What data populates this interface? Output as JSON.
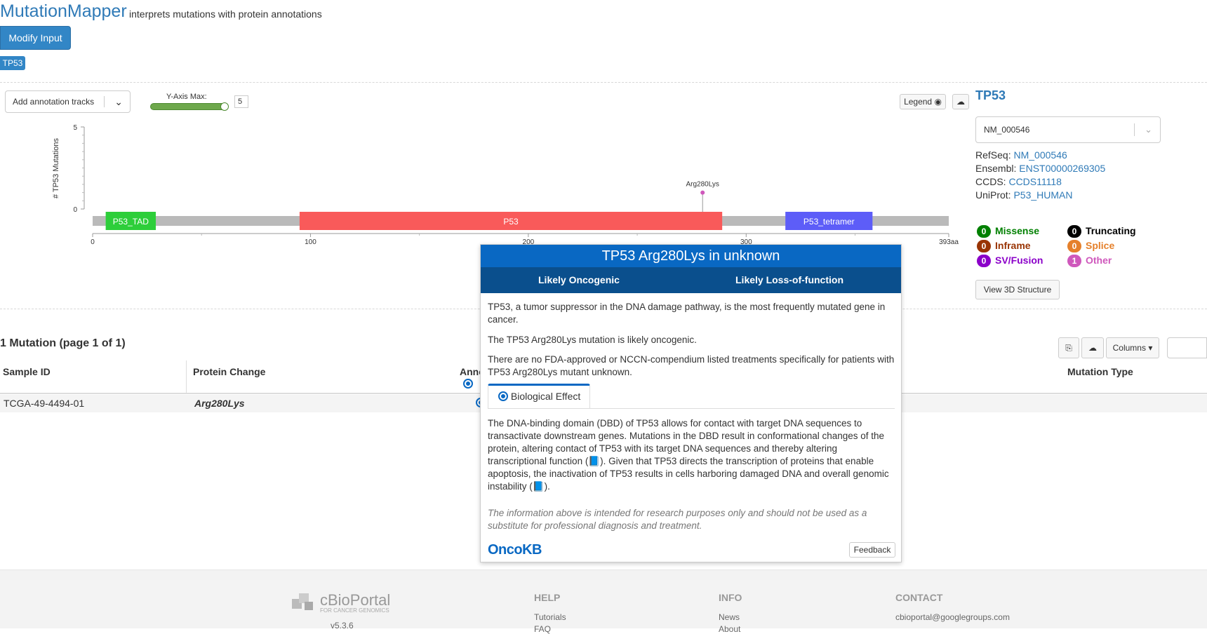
{
  "header": {
    "app_name": "MutationMapper",
    "subtitle": "interprets mutations with protein annotations",
    "modify_input_label": "Modify Input",
    "gene_tab": "TP53"
  },
  "controls": {
    "annotation_tracks_placeholder": "Add annotation tracks",
    "y_axis_label": "Y-Axis Max:",
    "y_axis_value": "5",
    "legend_button": "Legend"
  },
  "lollipop": {
    "y_label": "# TP53 Mutations",
    "y_ticks": [
      "5",
      "0"
    ],
    "x_ticks": [
      "0",
      "100",
      "200",
      "300",
      "393aa"
    ],
    "mutation_label": "Arg280Lys",
    "domains": [
      {
        "name": "P53_TAD",
        "color": "#2dce3a",
        "start": 6,
        "end": 29
      },
      {
        "name": "P53",
        "color": "#f95a5a",
        "start": 95,
        "end": 289
      },
      {
        "name": "P53_tetramer",
        "color": "#5d5df8",
        "start": 318,
        "end": 358
      }
    ],
    "protein_length": 393,
    "mutation_position": 280,
    "mutation_count": 1
  },
  "gene_panel": {
    "title": "TP53",
    "transcript": "NM_000546",
    "refseq_label": "RefSeq:",
    "refseq_value": "NM_000546",
    "ensembl_label": "Ensembl:",
    "ensembl_value": "ENST00000269305",
    "ccds_label": "CCDS:",
    "ccds_value": "CCDS11118",
    "uniprot_label": "UniProt:",
    "uniprot_value": "P53_HUMAN",
    "legend": [
      {
        "count": "0",
        "label": "Missense",
        "color": "#008000"
      },
      {
        "count": "0",
        "label": "Truncating",
        "color": "#000000"
      },
      {
        "count": "0",
        "label": "Inframe",
        "color": "#993404"
      },
      {
        "count": "0",
        "label": "Splice",
        "color": "#e5802b"
      },
      {
        "count": "0",
        "label": "SV/Fusion",
        "color": "#8b00c9"
      },
      {
        "count": "1",
        "label": "Other",
        "color": "#cf58bc"
      }
    ],
    "view_3d_label": "View 3D Structure"
  },
  "popup": {
    "title": "TP53 Arg280Lys in unknown",
    "oncogenicity": "Likely Oncogenic",
    "mutation_effect": "Likely Loss-of-function",
    "p1": "TP53, a tumor suppressor in the DNA damage pathway, is the most frequently mutated gene in cancer.",
    "p2": "The TP53 Arg280Lys mutation is likely oncogenic.",
    "p3": "There are no FDA-approved or NCCN-compendium listed treatments specifically for patients with TP53 Arg280Lys mutant unknown.",
    "tab_label": "Biological Effect",
    "bio_text": "The DNA-binding domain (DBD) of TP53 allows for contact with target DNA sequences to transactivate downstream genes. Mutations in the DBD result in conformational changes of the protein, altering contact of TP53 with its target DNA sequences and thereby altering transcriptional function (📘). Given that TP53 directs the transcription of proteins that enable apoptosis, the inactivation of TP53 results in cells harboring damaged DNA and overall genomic instability (📘).",
    "disclaimer": "The information above is intended for research purposes only and should not be used as a substitute for professional diagnosis and treatment.",
    "logo": "OncoKB",
    "feedback_label": "Feedback"
  },
  "table": {
    "title": "1 Mutation (page 1 of 1)",
    "columns_label": "Columns",
    "headers": {
      "sample": "Sample ID",
      "protein": "Protein Change",
      "annotation": "Annotation",
      "type": "Mutation Type"
    },
    "rows": [
      {
        "sample": "TCGA-49-4494-01",
        "protein": "Arg280Lys"
      }
    ]
  },
  "footer": {
    "logo_name": "cBioPortal",
    "logo_tag": "FOR CANCER GENOMICS",
    "version": "v5.3.6",
    "help_heading": "HELP",
    "help_link": "Tutorials",
    "help_link2": "FAQ",
    "info_heading": "INFO",
    "info_link": "News",
    "info_link2": "About",
    "contact_heading": "CONTACT",
    "contact_email": "cbioportal@googlegroups.com"
  }
}
